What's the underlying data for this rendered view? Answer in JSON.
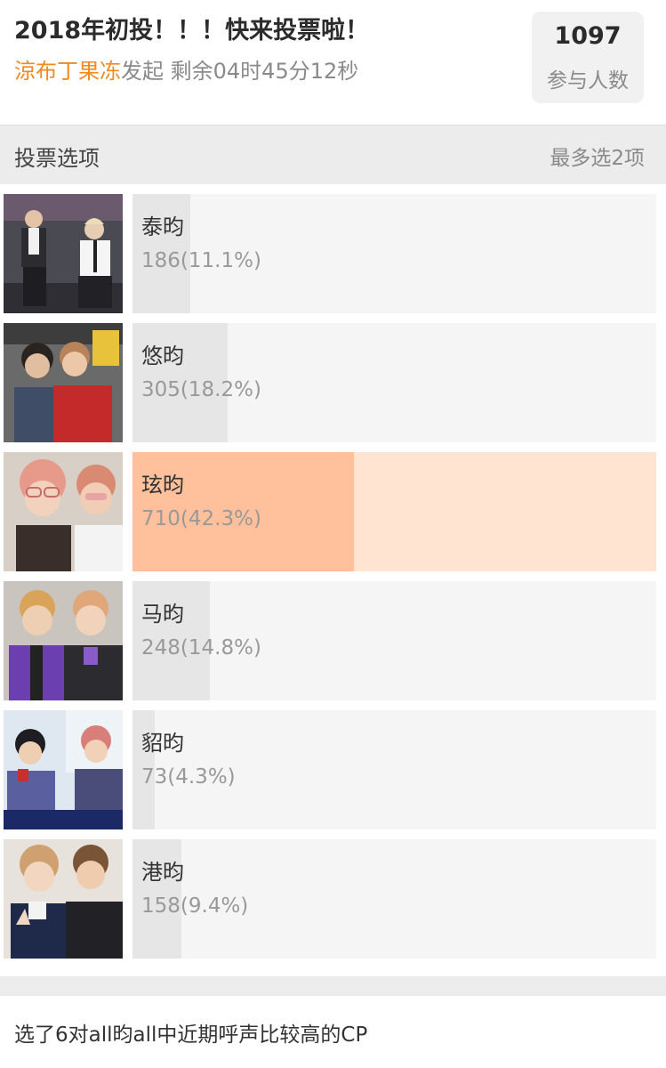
{
  "poll": {
    "title": "2018年初投！！！快来投票啦！",
    "author": "涼布丁果冻",
    "initiated_label": "发起",
    "time_left": "剩余04时45分12秒",
    "participants": "1097",
    "participants_label": "参与人数"
  },
  "section": {
    "title": "投票选项",
    "limit": "最多选2项"
  },
  "colors": {
    "author": "#f08a1c",
    "bar_default": "#e6e6e6",
    "bar_selected": "#ffc09b",
    "track_selected": "#ffe5d1"
  },
  "options": [
    {
      "label": "泰昀",
      "votes_text": "186(11.1%)",
      "percent": 11.1,
      "selected": false
    },
    {
      "label": "悠昀",
      "votes_text": "305(18.2%)",
      "percent": 18.2,
      "selected": false
    },
    {
      "label": "玹昀",
      "votes_text": "710(42.3%)",
      "percent": 42.3,
      "selected": true
    },
    {
      "label": "马昀",
      "votes_text": "248(14.8%)",
      "percent": 14.8,
      "selected": false
    },
    {
      "label": "貂昀",
      "votes_text": "73(4.3%)",
      "percent": 4.3,
      "selected": false
    },
    {
      "label": "港昀",
      "votes_text": "158(9.4%)",
      "percent": 9.4,
      "selected": false
    }
  ],
  "footer": {
    "description": "选了6对all昀all中近期呼声比较高的CP"
  }
}
